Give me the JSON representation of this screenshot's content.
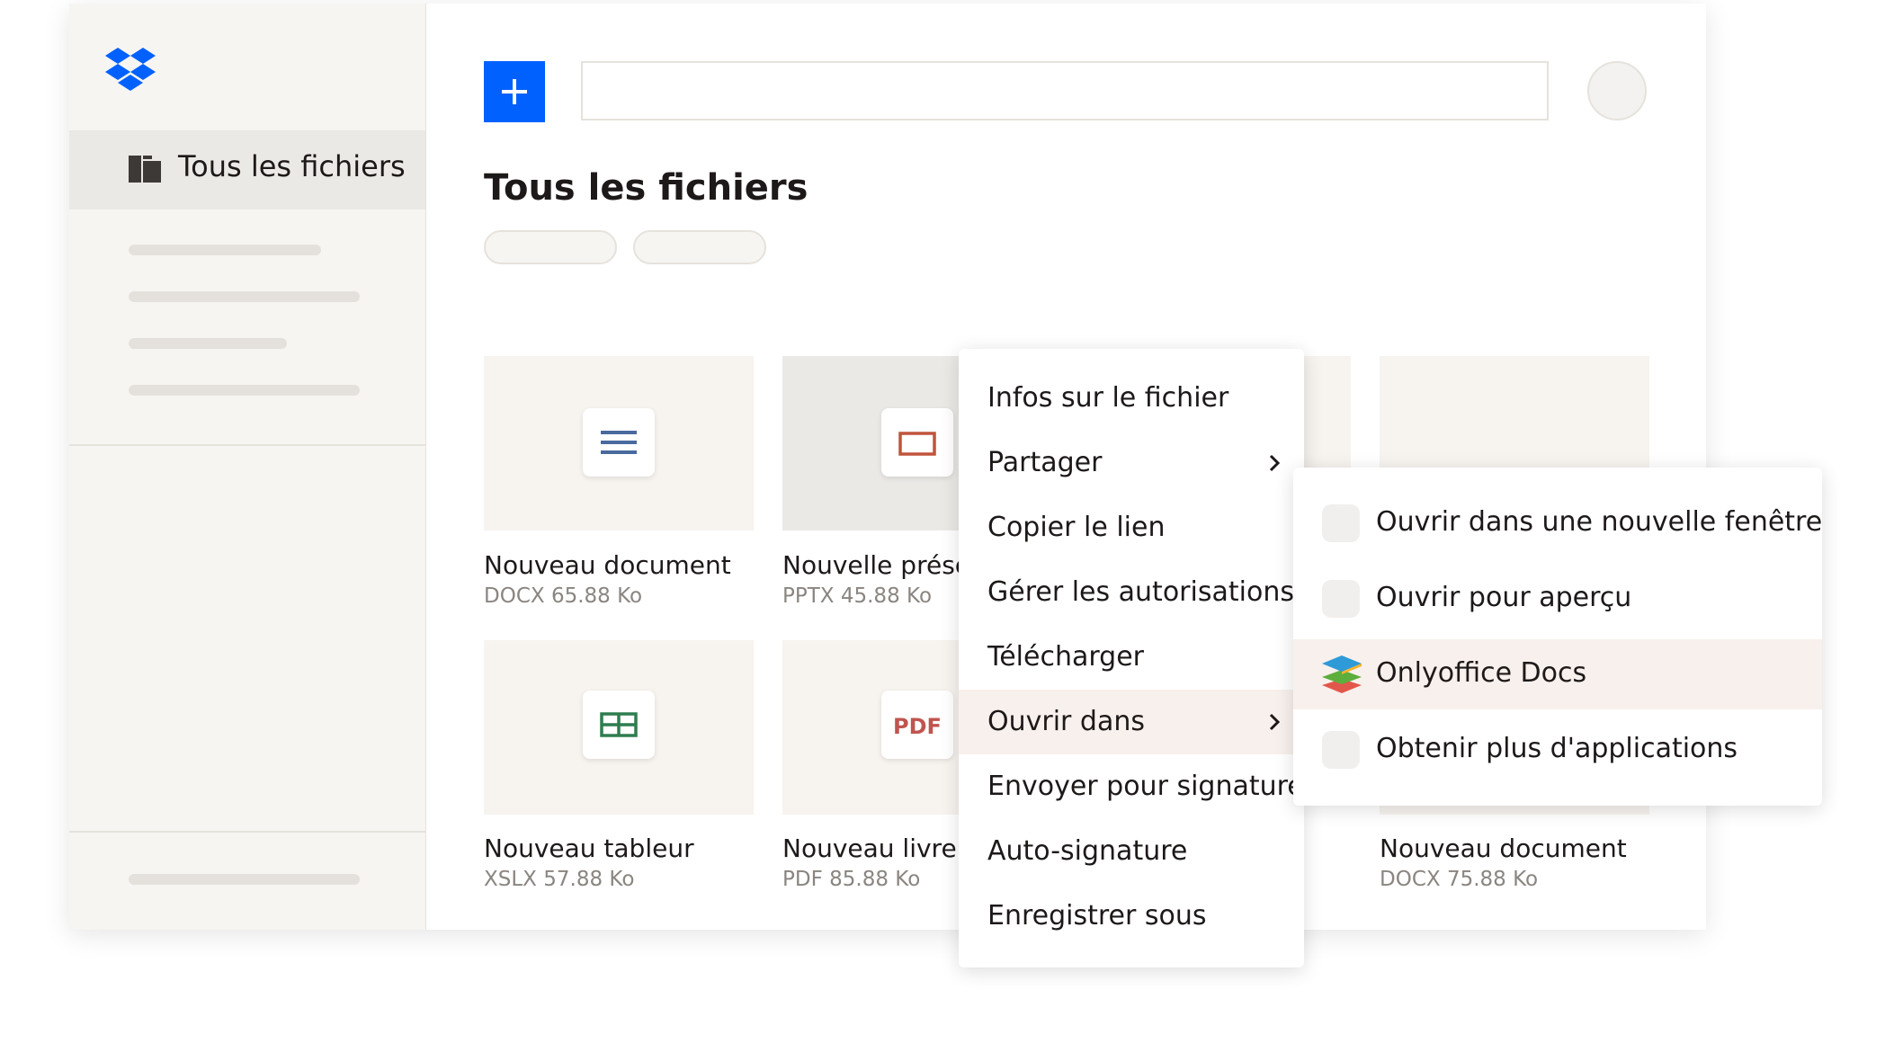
{
  "app": {
    "name": "Dropbox",
    "logo_icon": "dropbox-logo-icon",
    "accent_color": "#0061fe"
  },
  "sidebar": {
    "active_item": {
      "label": "Tous les fichiers",
      "icon": "folders-icon"
    }
  },
  "header": {
    "new_button_icon": "plus-icon",
    "search_value": "",
    "avatar_icon": "avatar"
  },
  "main": {
    "title": "Tous les fichiers",
    "files": [
      {
        "name": "Nouveau document",
        "meta": "DOCX 65.88 Ko",
        "icon": "document-lines-icon"
      },
      {
        "name": "Nouvelle prése",
        "meta": "PPTX 45.88 Ko",
        "icon": "presentation-icon"
      },
      {
        "name": "",
        "meta": "",
        "icon": "file-icon"
      },
      {
        "name": "Nouveau tableur",
        "meta": "XSLX 57.88 Ko",
        "icon": "spreadsheet-icon"
      },
      {
        "name": "Nouveau livre",
        "meta": "PDF 85.88 Ko",
        "icon": "pdf-icon",
        "icon_text": "PDF"
      },
      {
        "name": "Nouveau document",
        "meta": "DOCX 75.88 Ko",
        "icon": "document-icon"
      }
    ]
  },
  "context_menu": {
    "items": [
      {
        "label": "Infos sur le fichier"
      },
      {
        "label": "Partager",
        "has_submenu": true
      },
      {
        "label": "Copier le lien"
      },
      {
        "label": "Gérer les autorisations"
      },
      {
        "label": "Télécharger"
      },
      {
        "label": "Ouvrir dans",
        "has_submenu": true,
        "highlighted": true
      },
      {
        "label": "Envoyer pour signature"
      },
      {
        "label": "Auto-signature"
      },
      {
        "label": "Enregistrer sous"
      }
    ]
  },
  "submenu": {
    "items": [
      {
        "label": "Ouvrir dans une nouvelle fenêtre",
        "icon": "placeholder-app-icon"
      },
      {
        "label": "Ouvrir pour aperçu",
        "icon": "placeholder-app-icon"
      },
      {
        "label": "Onlyoffice Docs",
        "icon": "onlyoffice-icon",
        "highlighted": true
      },
      {
        "label": "Obtenir plus d'applications",
        "icon": "placeholder-app-icon"
      }
    ]
  },
  "colors": {
    "doc_icon": "#4a6a9e",
    "presentation_icon": "#c0543b",
    "spreadsheet_icon": "#2e7d4f",
    "pdf_icon": "#c0544f",
    "highlight": "#f8f0ec"
  }
}
